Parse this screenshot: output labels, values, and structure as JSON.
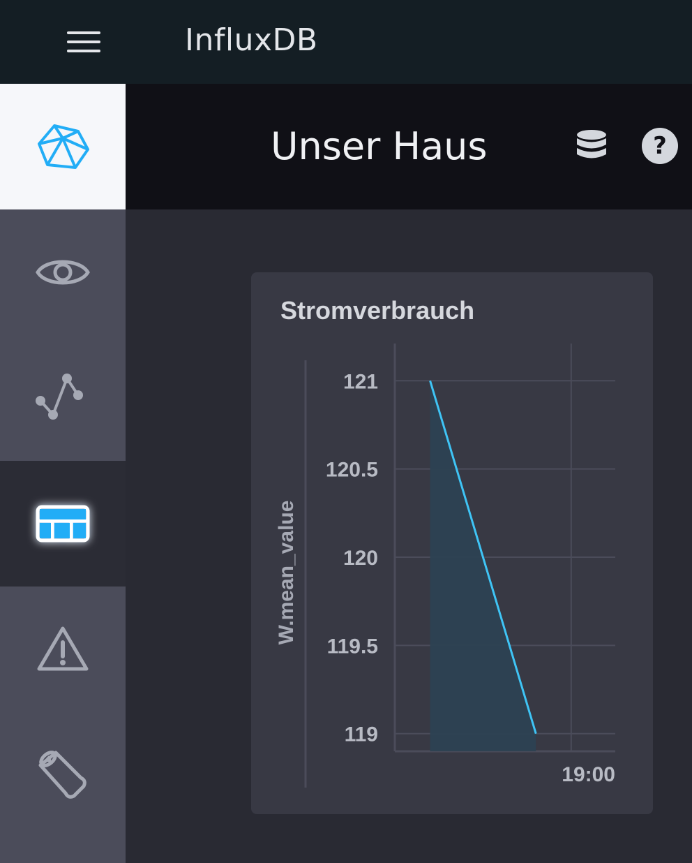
{
  "app": {
    "title": "InfluxDB"
  },
  "sidebar": {
    "items": [
      {
        "name": "home",
        "icon": "influx-logo-icon",
        "active": false
      },
      {
        "name": "data-explorer",
        "icon": "eye-icon",
        "active": false
      },
      {
        "name": "graph",
        "icon": "graph-icon",
        "active": false
      },
      {
        "name": "dashboards",
        "icon": "dashboard-icon",
        "active": true
      },
      {
        "name": "alerts",
        "icon": "alert-triangle-icon",
        "active": false
      },
      {
        "name": "logs",
        "icon": "wood-log-icon",
        "active": false
      }
    ]
  },
  "page": {
    "title": "Unser Haus",
    "help_label": "?"
  },
  "colors": {
    "accent": "#22adf6",
    "line": "#3fc4f5",
    "area": "#2c4153"
  },
  "cell": {
    "title": "Stromverbrauch"
  },
  "chart_data": {
    "type": "area",
    "title": "Stromverbrauch",
    "xlabel": "",
    "ylabel": "W.mean_value",
    "ylim": [
      118.9,
      121.1
    ],
    "yticks": [
      121,
      120.5,
      120,
      119.5,
      119
    ],
    "yticklabels": [
      "121",
      "120.5",
      "120",
      "119.5",
      "119"
    ],
    "xticklabels": [
      "19:00"
    ],
    "grid": true,
    "series": [
      {
        "points": [
          {
            "x": "18:44",
            "y": 121
          },
          {
            "x": "18:56",
            "y": 119
          }
        ]
      }
    ]
  }
}
